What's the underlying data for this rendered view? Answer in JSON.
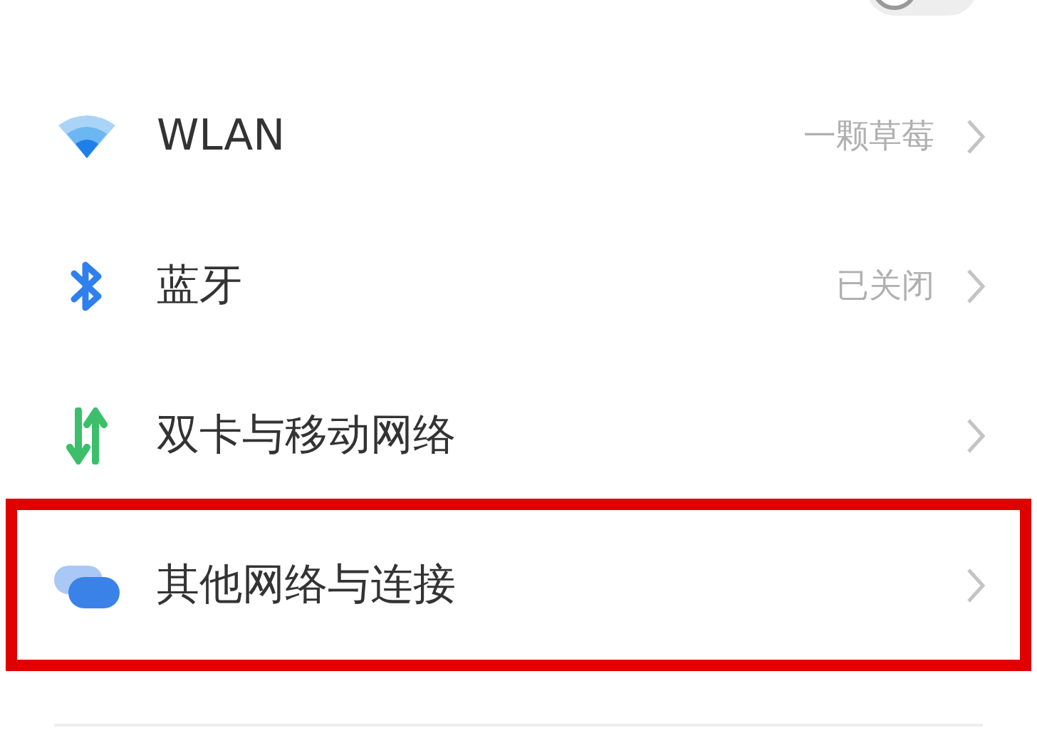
{
  "settings_items": [
    {
      "kind": "toggle",
      "on": false,
      "highlighted": false
    },
    {
      "kind": "link",
      "label": "WLAN",
      "value": "一颗草莓",
      "highlighted": false
    },
    {
      "kind": "link",
      "label": "蓝牙",
      "value": "已关闭",
      "highlighted": false
    },
    {
      "kind": "link",
      "label": "双卡与移动网络",
      "highlighted": false
    },
    {
      "kind": "link",
      "label": "其他网络与连接",
      "highlighted": true
    }
  ]
}
